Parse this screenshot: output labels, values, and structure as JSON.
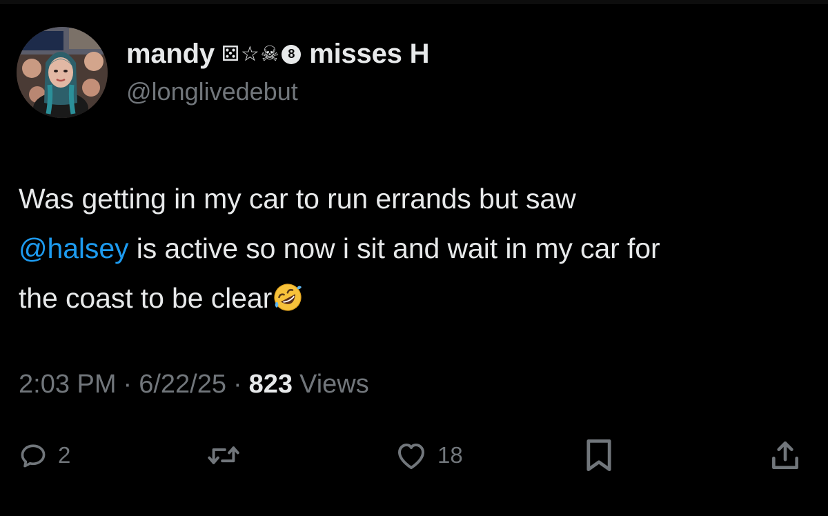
{
  "author": {
    "display_name": "mandy",
    "name_emojis": [
      "⚄",
      "☆",
      "☠"
    ],
    "badge_number": "8",
    "name_suffix": "misses H",
    "handle": "@longlivedebut",
    "avatar": "profile-photo"
  },
  "tweet": {
    "lines": [
      {
        "text": "Was getting in my car to run errands but saw"
      },
      {
        "mention": "@halsey",
        "text": " is active so now i sit and wait in my car for"
      },
      {
        "text": "the coast to be clear",
        "emoji": "rolling-on-floor-laughing"
      }
    ]
  },
  "meta": {
    "time": "2:03 PM",
    "separator": "·",
    "date": "6/22/25",
    "views_count": "823",
    "views_label": "Views"
  },
  "actions": {
    "reply_count": "2",
    "retweet_count": "",
    "like_count": "18",
    "icons": {
      "reply": "reply-icon",
      "retweet": "retweet-icon",
      "like": "heart-icon",
      "bookmark": "bookmark-icon",
      "share": "share-icon"
    }
  },
  "colors": {
    "background": "#000000",
    "text": "#e7e9ea",
    "secondary": "#71767b",
    "link": "#1d9bf0"
  }
}
